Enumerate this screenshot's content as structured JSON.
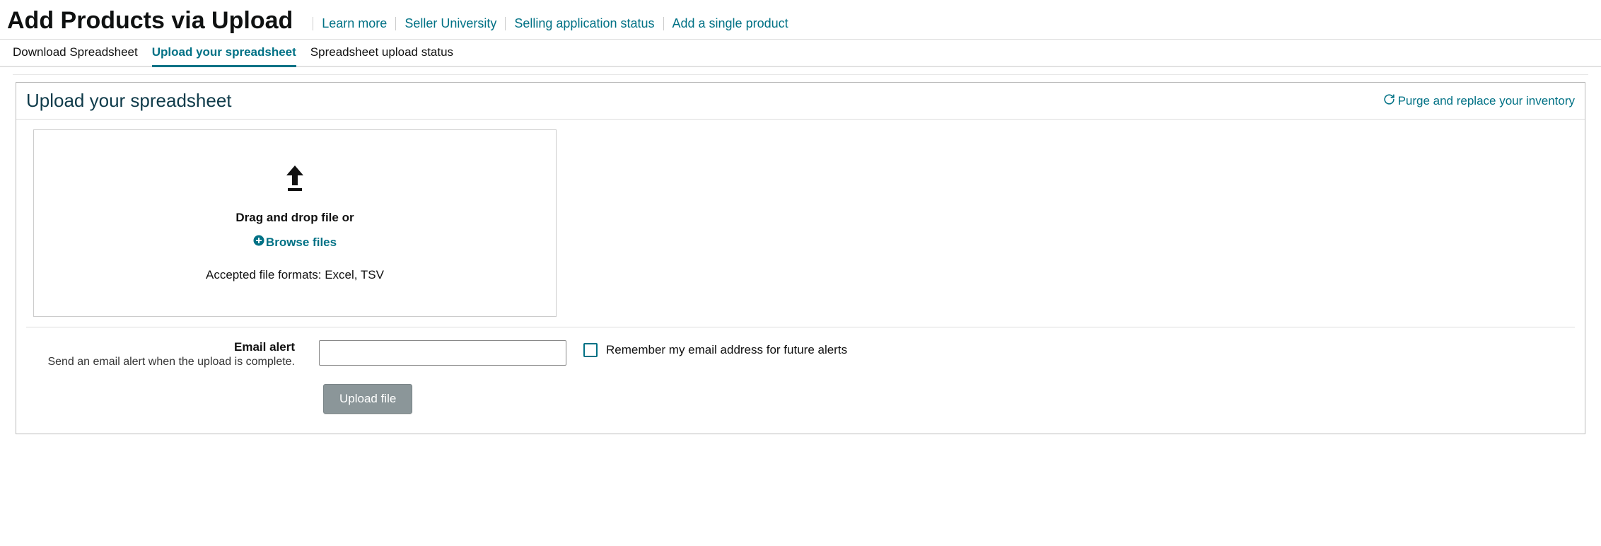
{
  "header": {
    "title": "Add Products via Upload",
    "links": [
      "Learn more",
      "Seller University",
      "Selling application status",
      "Add a single product"
    ]
  },
  "tabs": [
    {
      "label": "Download Spreadsheet",
      "active": false
    },
    {
      "label": "Upload your spreadsheet",
      "active": true
    },
    {
      "label": "Spreadsheet upload status",
      "active": false
    }
  ],
  "panel": {
    "title": "Upload your spreadsheet",
    "purge_link": "Purge and replace your inventory",
    "dropzone": {
      "drag_text": "Drag and drop file or",
      "browse_label": "Browse files",
      "accepted": "Accepted file formats: Excel, TSV"
    },
    "email_alert": {
      "label": "Email alert",
      "sub": "Send an email alert when the upload is complete.",
      "input_value": "",
      "input_placeholder": "",
      "remember_label": "Remember my email address for future alerts"
    },
    "upload_button": "Upload file"
  }
}
